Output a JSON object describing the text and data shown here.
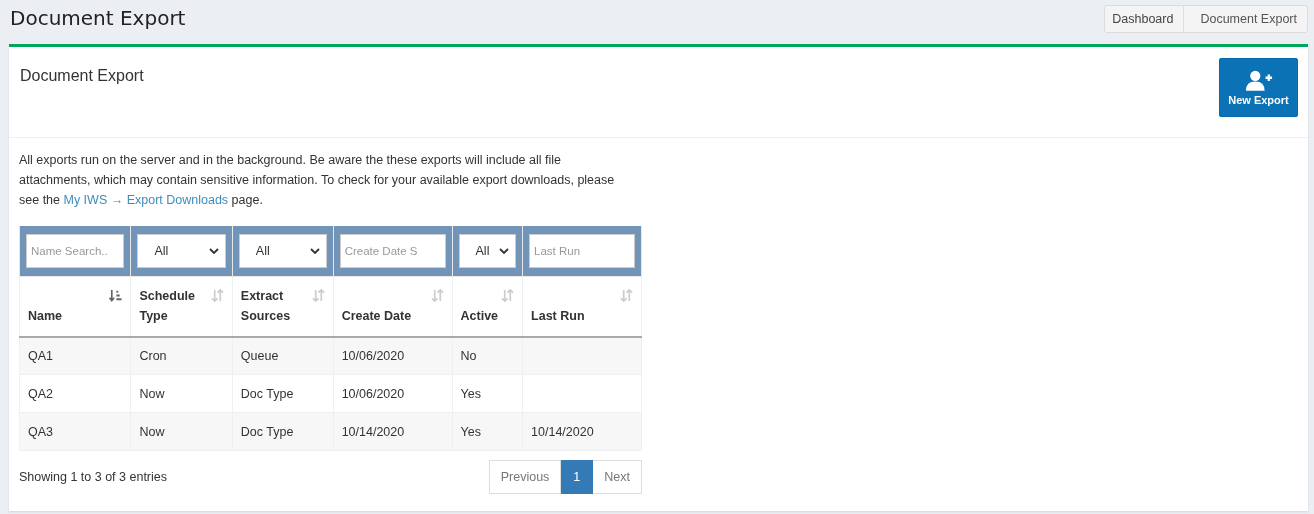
{
  "page_title": "Document Export",
  "breadcrumb": [
    {
      "label": "Dashboard",
      "selected": false
    },
    {
      "label": "Document Export",
      "selected": true
    }
  ],
  "card": {
    "title": "Document Export",
    "new_button": "New Export",
    "intro": {
      "before": "All exports run on the server and in the background. Be aware the these exports will include all file attachments, which may contain sensitive information. To check for your available export downloads, please see the ",
      "link": "My IWS → Export Downloads",
      "after": " page."
    }
  },
  "table": {
    "filters": [
      {
        "kind": "text",
        "placeholder": "Name Search.."
      },
      {
        "kind": "select",
        "value": "All"
      },
      {
        "kind": "select",
        "value": "All"
      },
      {
        "kind": "text",
        "placeholder": "Create Date S"
      },
      {
        "kind": "select",
        "value": "All"
      },
      {
        "kind": "text",
        "placeholder": "Last Run"
      }
    ],
    "columns": [
      {
        "label": "Name",
        "sorted": true
      },
      {
        "label": "Schedule Type",
        "sorted": false
      },
      {
        "label": "Extract Sources",
        "sorted": false
      },
      {
        "label": "Create Date",
        "sorted": false
      },
      {
        "label": "Active",
        "sorted": false
      },
      {
        "label": "Last Run",
        "sorted": false
      }
    ],
    "rows": [
      [
        "QA1",
        "Cron",
        "Queue",
        "10/06/2020",
        "No",
        ""
      ],
      [
        "QA2",
        "Now",
        "Doc Type",
        "10/06/2020",
        "Yes",
        ""
      ],
      [
        "QA3",
        "Now",
        "Doc Type",
        "10/14/2020",
        "Yes",
        "10/14/2020"
      ]
    ]
  },
  "info": "Showing 1 to 3 of 3 entries",
  "pagination": [
    {
      "label": "Previous",
      "selected": false
    },
    {
      "label": "1",
      "selected": true
    },
    {
      "label": "Next",
      "selected": false
    }
  ]
}
